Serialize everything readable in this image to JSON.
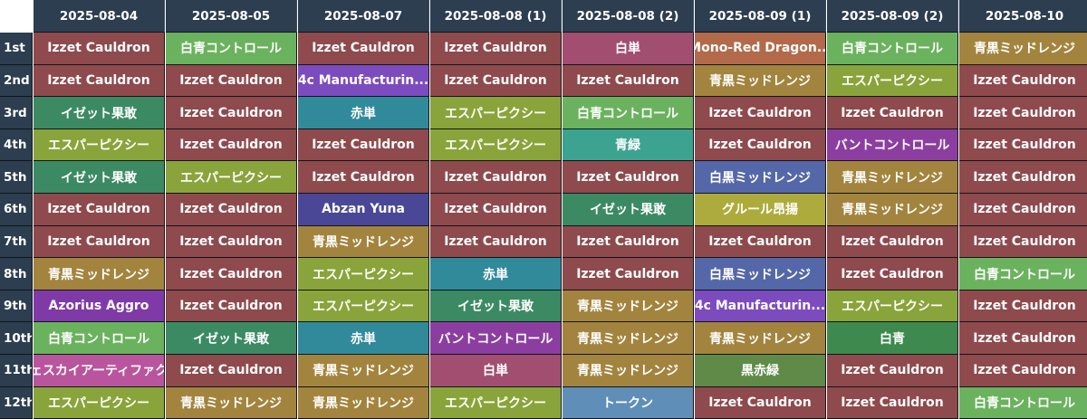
{
  "dates": [
    "2025-08-04",
    "2025-08-05",
    "2025-08-07",
    "2025-08-08 (1)",
    "2025-08-08 (2)",
    "2025-08-09 (1)",
    "2025-08-09 (2)",
    "2025-08-10"
  ],
  "ranks": [
    "1st",
    "2nd",
    "3rd",
    "4th",
    "5th",
    "6th",
    "7th",
    "8th",
    "9th",
    "10th",
    "11th",
    "12th"
  ],
  "decks": {
    "Izzet Cauldron": "#8e4a4c",
    "白青コントロール": "#6bb25e",
    "Mono-Red Dragon...": "#b26a4a",
    "白単": "#a14e70",
    "青黒ミッドレンジ": "#a3843e",
    "4c Manufacturin...": "#7c4cbf",
    "エスパーピクシー": "#89a43a",
    "イゼット果敢": "#3b8a63",
    "赤単": "#318a9a",
    "青緑": "#3ca390",
    "バントコントロール": "#8b3ea0",
    "白黒ミッドレンジ": "#5467a8",
    "Abzan Yuna": "#4a4896",
    "グルール昂揚": "#adab3c",
    "Azorius Aggro": "#7f3aa8",
    "白青": "#3e8a4e",
    "ヴェスカイアーティファクト": "#b9559c",
    "黒赤緑": "#5f8a48",
    "トークン": "#5f8fb8"
  },
  "rows": [
    [
      "Izzet Cauldron",
      "白青コントロール",
      "Izzet Cauldron",
      "Izzet Cauldron",
      "白単",
      "Mono-Red Dragon...",
      "白青コントロール",
      "青黒ミッドレンジ"
    ],
    [
      "Izzet Cauldron",
      "Izzet Cauldron",
      "4c Manufacturin...",
      "Izzet Cauldron",
      "Izzet Cauldron",
      "青黒ミッドレンジ",
      "エスパーピクシー",
      "Izzet Cauldron"
    ],
    [
      "イゼット果敢",
      "Izzet Cauldron",
      "赤単",
      "エスパーピクシー",
      "白青コントロール",
      "Izzet Cauldron",
      "Izzet Cauldron",
      "Izzet Cauldron"
    ],
    [
      "エスパーピクシー",
      "Izzet Cauldron",
      "Izzet Cauldron",
      "エスパーピクシー",
      "青緑",
      "Izzet Cauldron",
      "バントコントロール",
      "Izzet Cauldron"
    ],
    [
      "イゼット果敢",
      "エスパーピクシー",
      "Izzet Cauldron",
      "Izzet Cauldron",
      "Izzet Cauldron",
      "白黒ミッドレンジ",
      "青黒ミッドレンジ",
      "Izzet Cauldron"
    ],
    [
      "Izzet Cauldron",
      "Izzet Cauldron",
      "Abzan Yuna",
      "Izzet Cauldron",
      "イゼット果敢",
      "グルール昂揚",
      "青黒ミッドレンジ",
      "Izzet Cauldron"
    ],
    [
      "Izzet Cauldron",
      "Izzet Cauldron",
      "青黒ミッドレンジ",
      "Izzet Cauldron",
      "Izzet Cauldron",
      "Izzet Cauldron",
      "Izzet Cauldron",
      "Izzet Cauldron"
    ],
    [
      "青黒ミッドレンジ",
      "Izzet Cauldron",
      "エスパーピクシー",
      "赤単",
      "Izzet Cauldron",
      "白黒ミッドレンジ",
      "Izzet Cauldron",
      "白青コントロール"
    ],
    [
      "Azorius Aggro",
      "Izzet Cauldron",
      "エスパーピクシー",
      "イゼット果敢",
      "青黒ミッドレンジ",
      "4c Manufacturin...",
      "エスパーピクシー",
      "Izzet Cauldron"
    ],
    [
      "白青コントロール",
      "イゼット果敢",
      "赤単",
      "バントコントロール",
      "青黒ミッドレンジ",
      "青黒ミッドレンジ",
      "白青",
      "Izzet Cauldron"
    ],
    [
      "ヴェスカイアーティファクト",
      "Izzet Cauldron",
      "青黒ミッドレンジ",
      "白単",
      "青黒ミッドレンジ",
      "黒赤緑",
      "Izzet Cauldron",
      "Izzet Cauldron"
    ],
    [
      "エスパーピクシー",
      "青黒ミッドレンジ",
      "青黒ミッドレンジ",
      "エスパーピクシー",
      "トークン",
      "Izzet Cauldron",
      "Izzet Cauldron",
      "白青コントロール"
    ]
  ]
}
